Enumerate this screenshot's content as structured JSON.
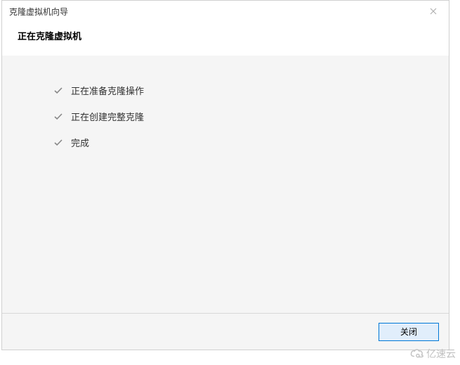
{
  "dialog": {
    "title": "克隆虚拟机向导",
    "header": "正在克隆虚拟机"
  },
  "steps": [
    {
      "label": "正在准备克隆操作"
    },
    {
      "label": "正在创建完整克隆"
    },
    {
      "label": "完成"
    }
  ],
  "footer": {
    "close_label": "关闭"
  },
  "watermark": {
    "text": "亿速云"
  }
}
